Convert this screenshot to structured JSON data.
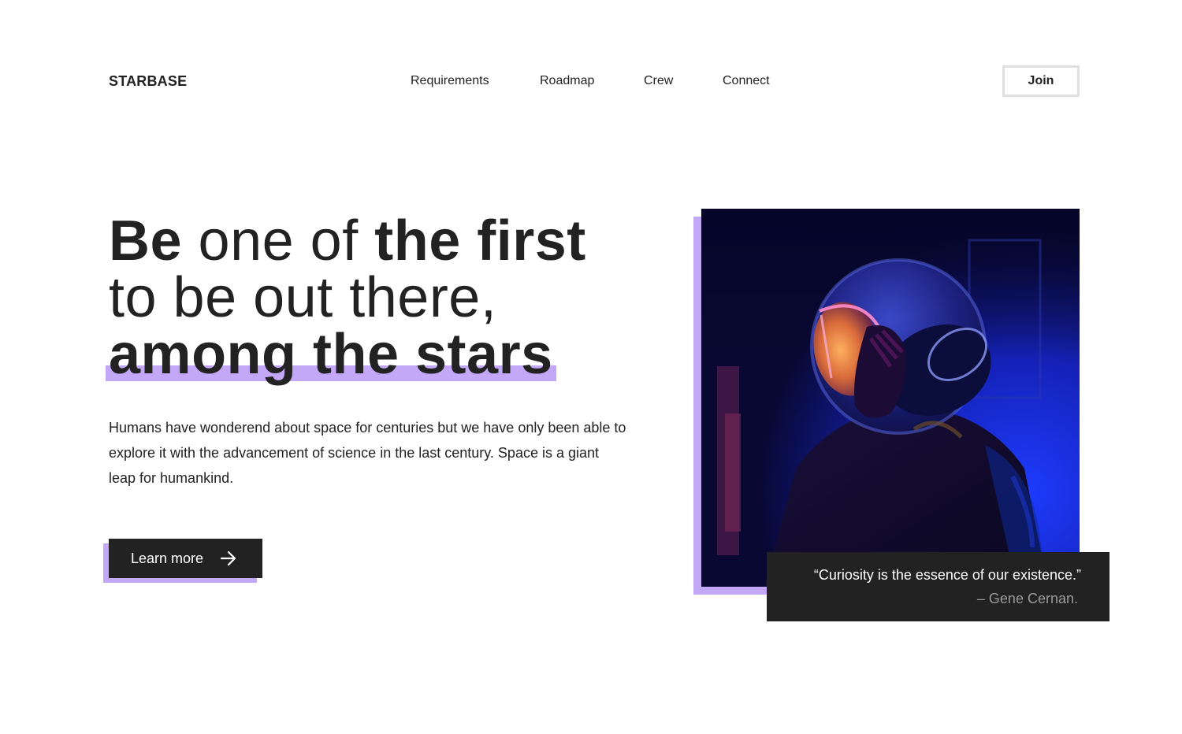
{
  "brand": {
    "logo": "STARBASE"
  },
  "nav": {
    "items": [
      {
        "label": "Requirements"
      },
      {
        "label": "Roadmap"
      },
      {
        "label": "Crew"
      },
      {
        "label": "Connect"
      }
    ],
    "join_label": "Join"
  },
  "hero": {
    "headline": {
      "line1_bold_a": "Be",
      "line1_light": " one of ",
      "line1_bold_b": "the first",
      "line2": "to be out there,",
      "line3": "among the stars"
    },
    "body": "Humans have wonderend about space for centuries but we have only been able to explore it with the advancement of science in the last century. Space is a giant leap for humankind.",
    "cta_label": "Learn more"
  },
  "quote": {
    "text": "“Curiosity is the essence of our existence.”",
    "author": "– Gene Cernan."
  },
  "colors": {
    "accent": "#c2a8f7",
    "dark": "#222222",
    "muted": "#9a9a9a"
  },
  "icons": {
    "cta_icon": "arrow-right-icon"
  }
}
